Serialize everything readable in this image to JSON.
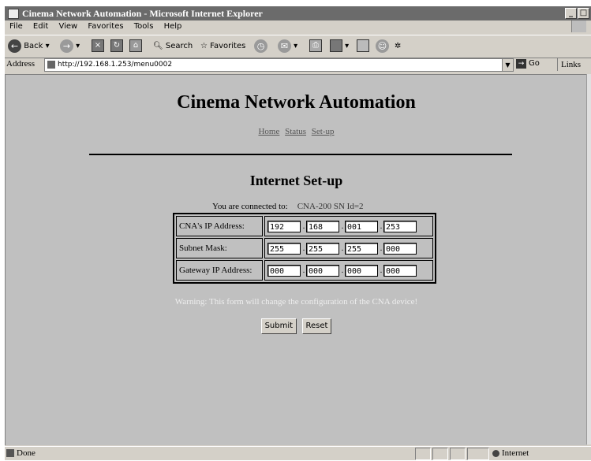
{
  "window": {
    "title": "Cinema Network Automation - Microsoft Internet Explorer",
    "min_glyph": "_",
    "max_glyph": "□"
  },
  "menu": [
    "File",
    "Edit",
    "View",
    "Favorites",
    "Tools",
    "Help"
  ],
  "toolbar": {
    "back": "Back",
    "search": "Search",
    "favorites": "Favorites"
  },
  "address": {
    "label": "Address",
    "url": "http://192.168.1.253/menu0002",
    "go": "Go",
    "links": "Links"
  },
  "page": {
    "heading": "Cinema Network Automation",
    "nav": [
      "Home",
      "Status",
      "Set-up"
    ],
    "subheading": "Internet Set-up",
    "connected_label": "You are connected to:",
    "connected_value": "CNA-200 SN Id=2",
    "rows": [
      {
        "label": "CNA's IP Address:",
        "octets": [
          "192",
          "168",
          "001",
          "253"
        ]
      },
      {
        "label": "Subnet Mask:",
        "octets": [
          "255",
          "255",
          "255",
          "000"
        ]
      },
      {
        "label": "Gateway IP Address:",
        "octets": [
          "000",
          "000",
          "000",
          "000"
        ]
      }
    ],
    "warning": "Warning: This form will change the configuration of the CNA device!",
    "submit": "Submit",
    "reset": "Reset"
  },
  "status": {
    "text": "Done",
    "zone": "Internet"
  },
  "colors": {
    "page_bg": "#c0c0c0",
    "warning_text": "#eeeeee",
    "nav_link": "#555555"
  }
}
